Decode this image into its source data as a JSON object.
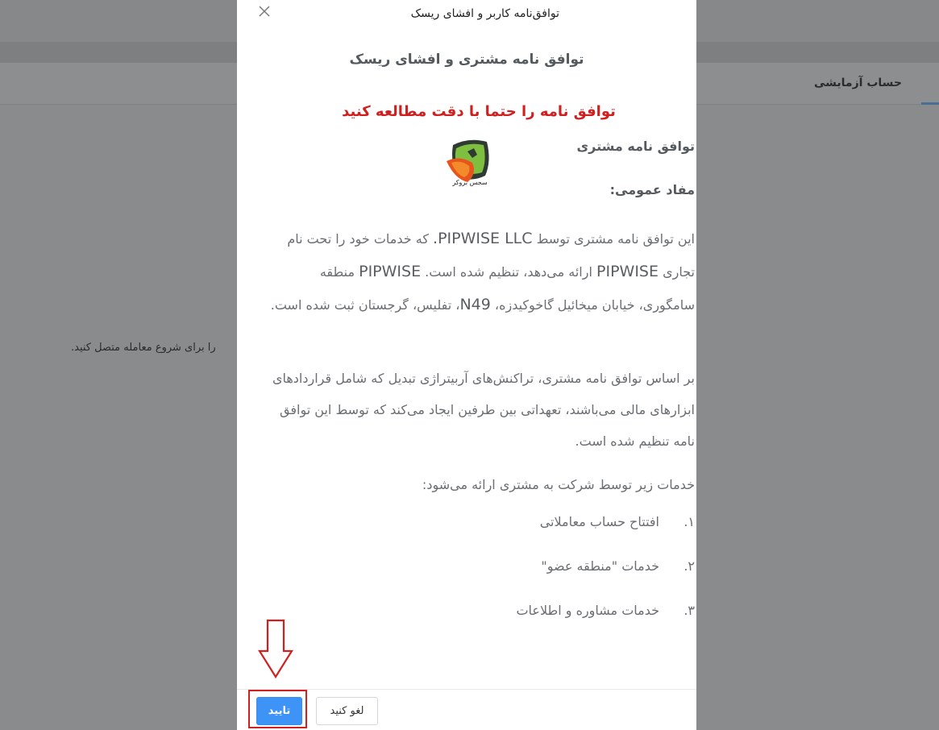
{
  "background": {
    "tab_demo_account": "حساب آزمایشی",
    "connect_prompt": "را برای شروع معامله متصل کنید."
  },
  "modal": {
    "title": "توافق‌نامه کاربر و افشای ریسک",
    "doc_title": "توافق نامه مشتری و افشای ریسک",
    "warning": "توافق نامه را حتما با دقت مطالعه کنید",
    "logo_caption": "سجس بروکر",
    "section_customer_agreement": "توافق نامه مشتری",
    "section_general_terms": "مفاد عمومی:",
    "paragraph1": {
      "part1": "این توافق نامه مشتری  توسط ",
      "company": "PIPWISE LLC.",
      "part2": " که خدمات خود را تحت نام تجاری ",
      "brand": "PIPWISE",
      "part3": " ارائه می‌دهد، تنظیم شده است.  ",
      "brand2": "PIPWISE",
      "part4": " منطقه سامگوری، خیابان میخائیل گاخوکیدزه، ",
      "street_no": "N49",
      "part5": "، تفلیس، گرجستان ثبت شده است."
    },
    "paragraph2": "بر اساس توافق نامه مشتری، تراکنش‌های آربیتراژی تبدیل که شامل قراردادهای ابزارهای مالی می‌باشند، تعهداتی بین طرفین ایجاد می‌کند که توسط این توافق نامه تنظیم شده است.",
    "paragraph3": "خدمات زیر توسط شرکت به مشتری ارائه می‌شود:",
    "services": [
      {
        "num": "۱.",
        "text": "افتتاح حساب معاملاتی"
      },
      {
        "num": "۲.",
        "text": "خدمات \"منطقه عضو\""
      },
      {
        "num": "۳.",
        "text": "خدمات مشاوره و اطلاعات"
      }
    ],
    "confirm_label": "تایید",
    "cancel_label": "لغو کنید"
  },
  "colors": {
    "accent": "#3d94f6",
    "warning": "#d01f1f",
    "annotation": "#d12020"
  }
}
